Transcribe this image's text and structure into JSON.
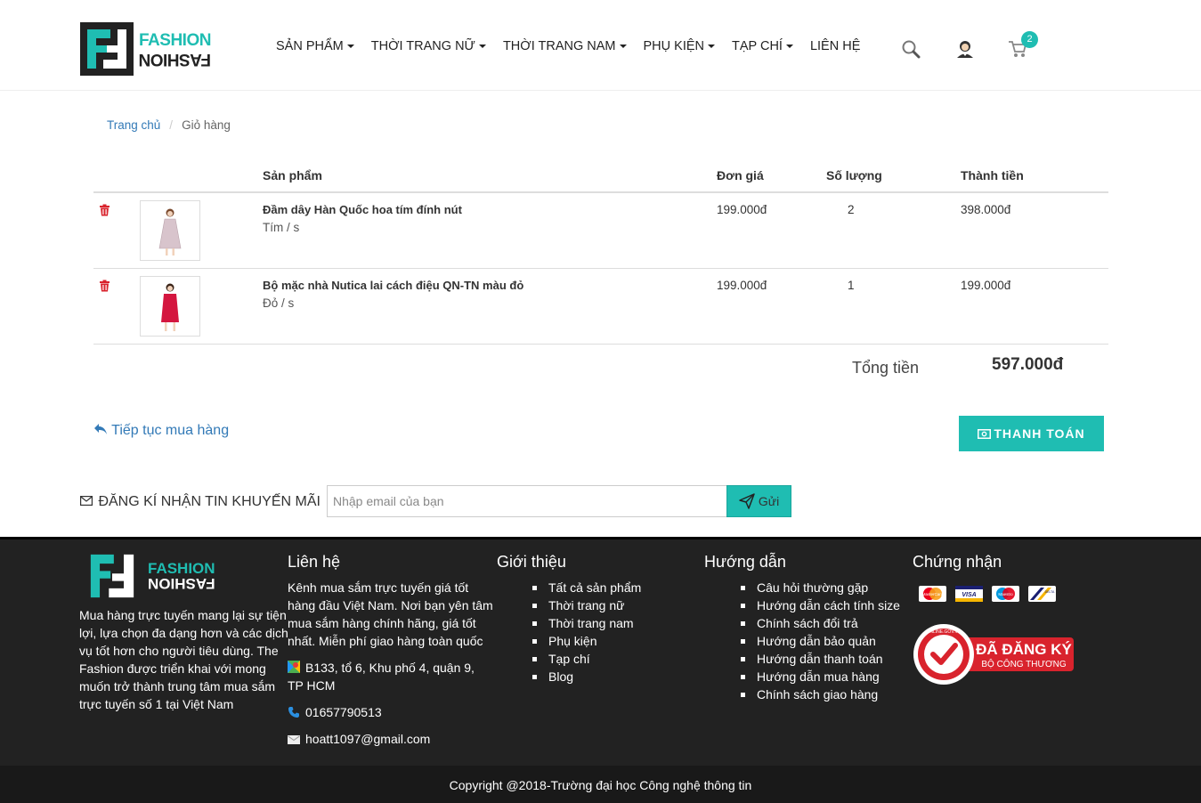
{
  "brand": {
    "name_top": "FASHION",
    "name_bottom": "FASHION"
  },
  "nav": [
    {
      "label": "SẢN PHẨM",
      "dropdown": true
    },
    {
      "label": "THỜI TRANG NỮ",
      "dropdown": true
    },
    {
      "label": "THỜI TRANG NAM",
      "dropdown": true
    },
    {
      "label": "PHỤ KIỆN",
      "dropdown": true
    },
    {
      "label": "TẠP CHÍ",
      "dropdown": true
    },
    {
      "label": "LIÊN HỆ",
      "dropdown": false
    }
  ],
  "header_icons": {
    "search": "search-icon",
    "account": "user-icon",
    "cart": "cart-icon",
    "cart_count": "2"
  },
  "breadcrumb": {
    "home": "Trang chủ",
    "separator": "/",
    "current": "Giỏ hàng"
  },
  "cart": {
    "headers": {
      "product": "Sản phẩm",
      "unit_price": "Đơn giá",
      "quantity": "Số lượng",
      "subtotal": "Thành tiền"
    },
    "items": [
      {
        "name": "Đầm dây Hàn Quốc hoa tím đính nút",
        "variant": "Tím / s",
        "unit_price": "199.000đ",
        "quantity": "2",
        "subtotal": "398.000đ"
      },
      {
        "name": "Bộ mặc nhà Nutica lai cách điệu QN-TN màu đỏ",
        "variant": "Đỏ / s",
        "unit_price": "199.000đ",
        "quantity": "1",
        "subtotal": "199.000đ"
      }
    ],
    "total_label": "Tổng tiền",
    "total_value": "597.000đ",
    "continue_label": "Tiếp tục mua hàng",
    "checkout_label": "THANH TOÁN"
  },
  "newsletter": {
    "label": "ĐĂNG KÍ NHẬN TIN KHUYẾN MÃI",
    "placeholder": "Nhập email của bạn",
    "button": "Gửi"
  },
  "footer": {
    "about": "Mua hàng trực tuyến mang lại sự tiện lợi, lựa chọn đa dạng hơn và các dịch vụ tốt hơn cho người tiêu dùng. The Fashion được triển khai với mong muốn trở thành trung tâm mua sắm trực tuyến số 1 tại Việt Nam",
    "contact": {
      "title": "Liên hệ",
      "intro": "Kênh mua sắm trực tuyến giá tốt hàng đầu Việt Nam. Nơi bạn yên tâm mua sắm hàng chính hãng, giá tốt nhất. Miễn phí giao hàng toàn quốc",
      "address": "B133, tổ 6, Khu phố 4, quận 9, TP HCM",
      "phone": "01657790513",
      "email": "hoatt1097@gmail.com"
    },
    "intro": {
      "title": "Giới thiệu",
      "links": [
        "Tất cả sản phẩm",
        "Thời trang nữ",
        "Thời trang nam",
        "Phụ kiện",
        "Tạp chí",
        "Blog"
      ]
    },
    "guide": {
      "title": "Hướng dẫn",
      "links": [
        "Câu hỏi thường gặp",
        "Hướng dẫn cách tính size",
        "Chính sách đổi trả",
        "Hướng dẫn bảo quản",
        "Hướng dẫn thanh toán",
        "Hướng dẫn mua hàng",
        "Chính sách giao hàng"
      ]
    },
    "cert": {
      "title": "Chứng nhận",
      "badge_main": "ĐÃ ĐĂNG KÝ",
      "badge_sub": "BỘ CÔNG THƯƠNG",
      "badge_ring": "ONLINE.GOV.VN",
      "cards": [
        "MasterCard",
        "VISA",
        "Maestro",
        "DELTA"
      ]
    },
    "copyright": "Copyright @2018-Trường đại học Công nghệ thông tin"
  },
  "colors": {
    "accent": "#1fbdb2",
    "link": "#337ab7",
    "danger": "#d9232d",
    "footer_bg": "#222222"
  }
}
